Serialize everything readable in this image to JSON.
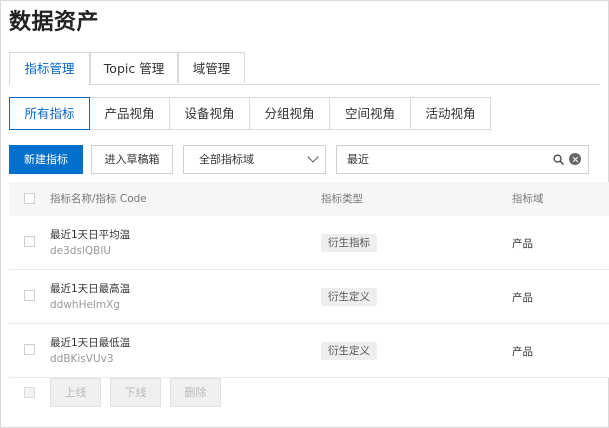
{
  "page": {
    "title": "数据资产"
  },
  "tabs": [
    {
      "label": "指标管理",
      "active": true
    },
    {
      "label": "Topic 管理",
      "active": false
    },
    {
      "label": "域管理",
      "active": false
    }
  ],
  "views": [
    {
      "label": "所有指标",
      "active": true
    },
    {
      "label": "产品视角",
      "active": false
    },
    {
      "label": "设备视角",
      "active": false
    },
    {
      "label": "分组视角",
      "active": false
    },
    {
      "label": "空间视角",
      "active": false
    },
    {
      "label": "活动视角",
      "active": false
    }
  ],
  "toolbar": {
    "new_label": "新建指标",
    "drafts_label": "进入草稿箱",
    "domain_select_value": "全部指标域",
    "search_value": "最近"
  },
  "table": {
    "headers": {
      "name": "指标名称/指标 Code",
      "type": "指标类型",
      "domain": "指标域"
    },
    "rows": [
      {
        "name": "最近1天日平均温",
        "code": "de3dslQBIU",
        "type": "衍生指标",
        "domain": "产品"
      },
      {
        "name": "最近1天日最高温",
        "code": "ddwhHelmXg",
        "type": "衍生定义",
        "domain": "产品"
      },
      {
        "name": "最近1天日最低温",
        "code": "ddBKisVUv3",
        "type": "衍生定义",
        "domain": "产品"
      }
    ]
  },
  "footer": {
    "online_label": "上线",
    "offline_label": "下线",
    "delete_label": "删除"
  },
  "colors": {
    "accent": "#0070cc",
    "active_text": "#0a67c4"
  }
}
